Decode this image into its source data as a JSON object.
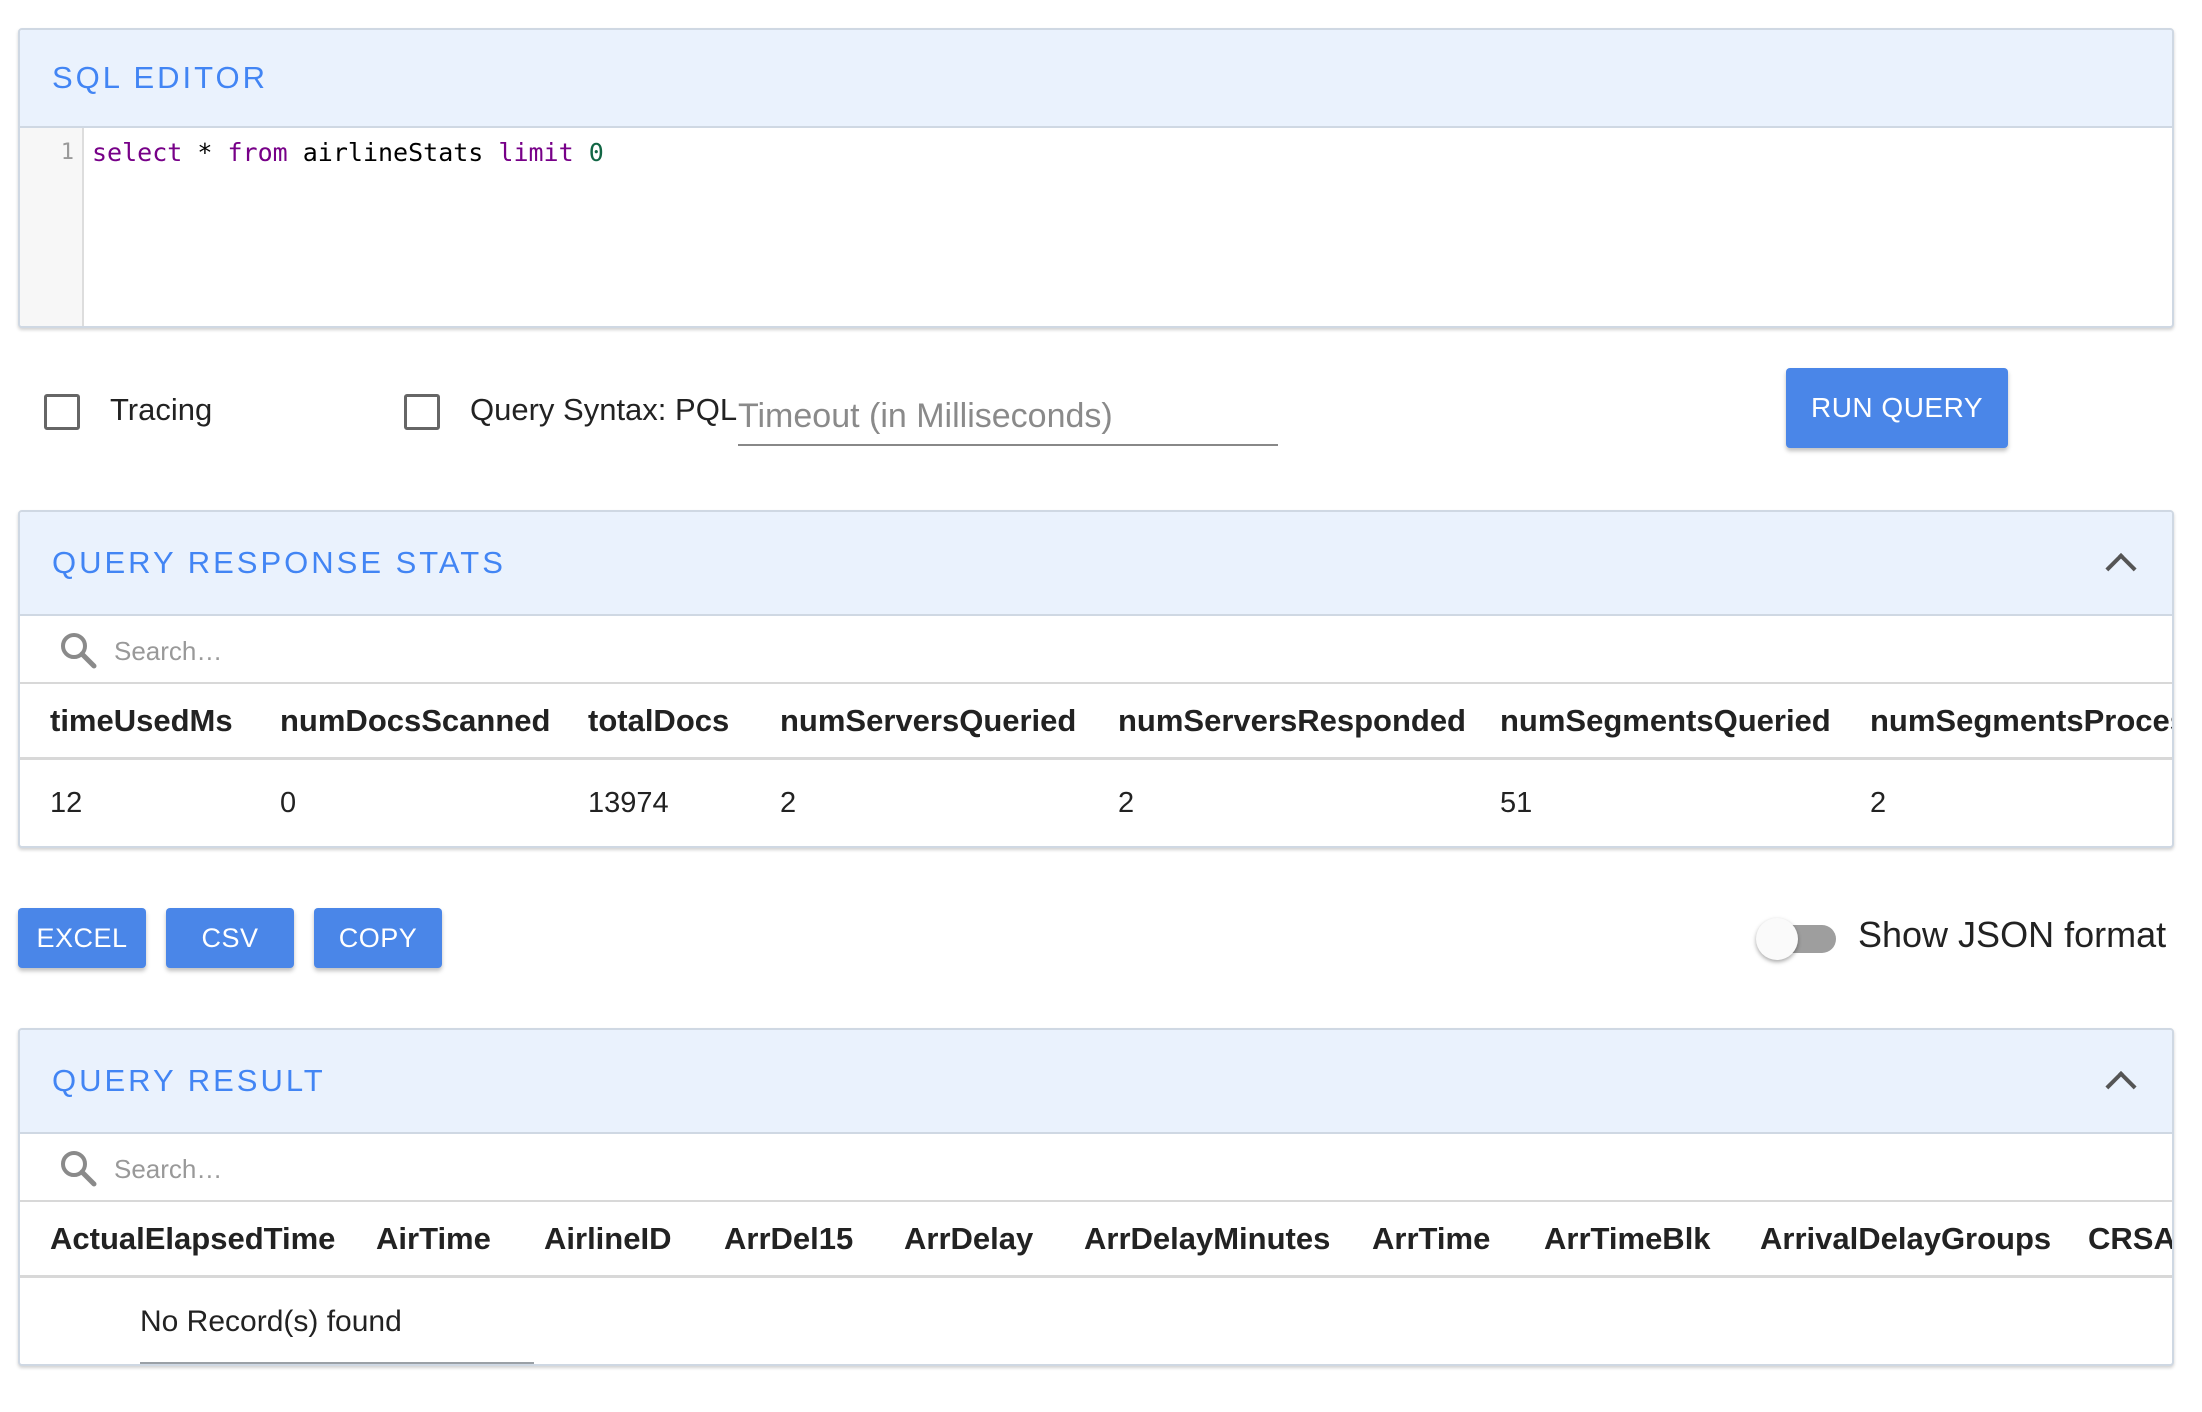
{
  "sql_editor": {
    "title": "SQL EDITOR",
    "line_number": "1",
    "code_tokens": [
      {
        "text": "select",
        "kind": "keyword"
      },
      {
        "text": " * ",
        "kind": "plain"
      },
      {
        "text": "from",
        "kind": "keyword"
      },
      {
        "text": " airlineStats ",
        "kind": "plain"
      },
      {
        "text": "limit",
        "kind": "keyword"
      },
      {
        "text": " 0",
        "kind": "number"
      }
    ]
  },
  "controls": {
    "tracing_label": "Tracing",
    "tracing_checked": false,
    "query_syntax_label": "Query Syntax: PQL",
    "query_syntax_checked": false,
    "timeout_placeholder": "Timeout (in Milliseconds)",
    "timeout_value": "",
    "run_query_label": "RUN QUERY"
  },
  "stats": {
    "title": "QUERY RESPONSE STATS",
    "search_placeholder": "Search…",
    "columns": [
      "timeUsedMs",
      "numDocsScanned",
      "totalDocs",
      "numServersQueried",
      "numServersResponded",
      "numSegmentsQueried",
      "numSegmentsProcess"
    ],
    "rows": [
      [
        "12",
        "0",
        "13974",
        "2",
        "2",
        "51",
        "2"
      ]
    ]
  },
  "export": {
    "excel_label": "EXCEL",
    "csv_label": "CSV",
    "copy_label": "COPY",
    "json_toggle_label": "Show JSON format",
    "json_toggle_on": false
  },
  "result": {
    "title": "QUERY RESULT",
    "search_placeholder": "Search…",
    "columns": [
      "ActualElapsedTime",
      "AirTime",
      "AirlineID",
      "ArrDel15",
      "ArrDelay",
      "ArrDelayMinutes",
      "ArrTime",
      "ArrTimeBlk",
      "ArrivalDelayGroups",
      "CRSArr"
    ],
    "empty_text": "No Record(s) found"
  },
  "colors": {
    "accent": "#4285f4",
    "button": "#4a86e8",
    "header_bg": "#eaf2fd",
    "keyword": "#770088",
    "number": "#116644"
  },
  "icons": {
    "search": "search-icon",
    "collapse": "chevron-up-icon"
  }
}
